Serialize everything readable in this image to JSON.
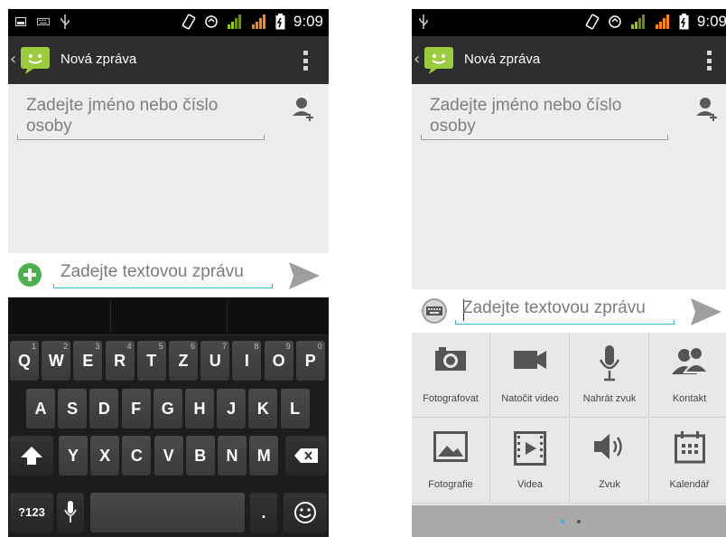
{
  "status": {
    "time": "9:09"
  },
  "left": {
    "title": "Nová zpráva",
    "recipient_placeholder": "Zadejte jméno nebo číslo osoby",
    "compose_placeholder": "Zadejte textovou zprávu",
    "keyboard": {
      "row1": [
        {
          "label": "Q",
          "hint": "1"
        },
        {
          "label": "W",
          "hint": "2"
        },
        {
          "label": "E",
          "hint": "3"
        },
        {
          "label": "R",
          "hint": "4"
        },
        {
          "label": "T",
          "hint": "5"
        },
        {
          "label": "Z",
          "hint": "6"
        },
        {
          "label": "U",
          "hint": "7"
        },
        {
          "label": "I",
          "hint": "8"
        },
        {
          "label": "O",
          "hint": "9"
        },
        {
          "label": "P",
          "hint": "0"
        }
      ],
      "row2": [
        "A",
        "S",
        "D",
        "F",
        "G",
        "H",
        "J",
        "K",
        "L"
      ],
      "row3": [
        "Y",
        "X",
        "C",
        "V",
        "B",
        "N",
        "M"
      ],
      "symbols_key": "?123",
      "period_key": "."
    }
  },
  "right": {
    "title": "Nová zpráva",
    "recipient_placeholder": "Zadejte jméno nebo číslo osoby",
    "compose_placeholder": "Zadejte textovou zprávu",
    "attachments": [
      {
        "label": "Fotografovat",
        "icon": "camera-icon"
      },
      {
        "label": "Natočit video",
        "icon": "video-camera-icon"
      },
      {
        "label": "Nahrát zvuk",
        "icon": "microphone-icon"
      },
      {
        "label": "Kontakt",
        "icon": "contact-icon"
      },
      {
        "label": "Fotografie",
        "icon": "picture-icon"
      },
      {
        "label": "Videa",
        "icon": "film-icon"
      },
      {
        "label": "Zvuk",
        "icon": "speaker-icon"
      },
      {
        "label": "Kalendář",
        "icon": "calendar-icon"
      }
    ]
  },
  "colors": {
    "accent": "#33b5e5",
    "signal": "#ff8800",
    "signal_dim": "#99cc00"
  }
}
